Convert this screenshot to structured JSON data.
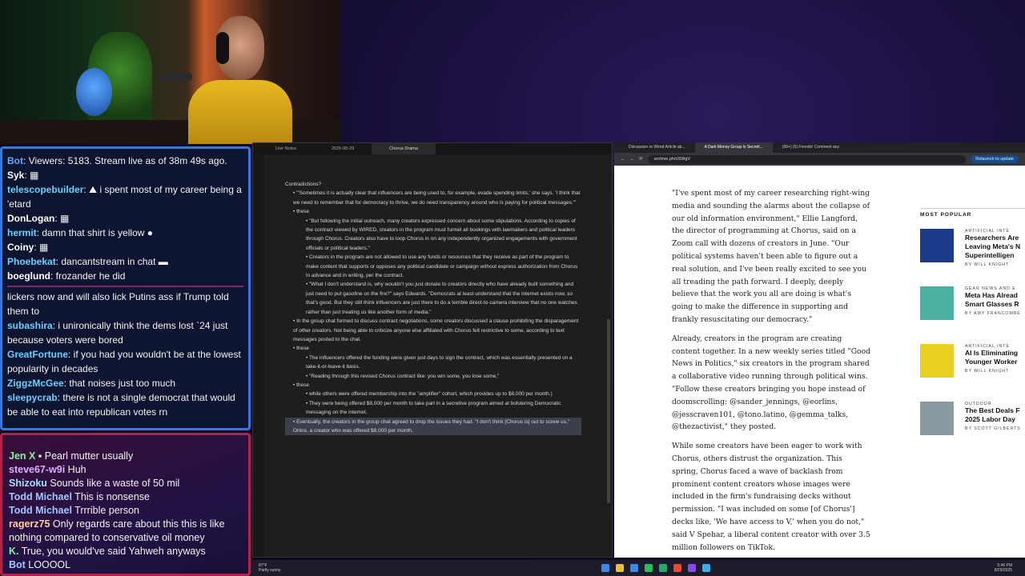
{
  "chat_top": [
    {
      "user": "Bot",
      "color": "#6aa8ff",
      "text": ": Viewers: 5183. Stream live as of 38m 49s ago."
    },
    {
      "user": "Syk",
      "color": "#ffffff",
      "text": ": ▦"
    },
    {
      "user": "telescopebuilder",
      "color": "#6ad0ff",
      "text": ": ⛰ i spent most of my career being a 'etard"
    },
    {
      "user": "DonLogan",
      "color": "#ffffff",
      "text": ": ▦"
    },
    {
      "user": "hermit",
      "color": "#6ad0ff",
      "text": ": damn that shirt is yellow ●"
    },
    {
      "user": "Coiny",
      "color": "#ffffff",
      "text": ": ▦"
    },
    {
      "user": "Phoebekat",
      "color": "#6ad0ff",
      "text": ": dancantstream in chat ▬"
    },
    {
      "user": "boeglund",
      "color": "#ffffff",
      "text": ": frozander he did"
    },
    {
      "user": "",
      "color": "#ffffff",
      "text": "lickers now and will also lick Putins ass if Trump told them to"
    },
    {
      "user": "subashira",
      "color": "#6ad0ff",
      "text": ":  i unironically think the dems lost `24 just because voters were bored"
    },
    {
      "user": "GreatFortune",
      "color": "#6ad0ff",
      "text": ":  if you had you wouldn't be at the lowest popularity in decades"
    },
    {
      "user": "ZiggzMcGee",
      "color": "#6ad0ff",
      "text": ":  that noises just too much"
    },
    {
      "user": "sleepycrab",
      "color": "#6ad0ff",
      "text": ":  there is not a single democrat that would be able to eat into republican votes rn"
    }
  ],
  "chat_bottom": [
    {
      "user": "Jen X",
      "color": "#8af0a0",
      "text": " ▪ Pearl mutter usually"
    },
    {
      "user": "steve67-w9i",
      "color": "#d8b0ff",
      "text": " Huh"
    },
    {
      "user": "Shizoku",
      "color": "#a0e0ff",
      "text": " Sounds like a waste of 50 mil"
    },
    {
      "user": "Todd Michael",
      "color": "#a0c8ff",
      "text": " This is nonsense"
    },
    {
      "user": "Todd Michael",
      "color": "#a0c8ff",
      "text": " Trrrible person"
    },
    {
      "user": "ragerz75",
      "color": "#ffd0a0",
      "text": " Only regards care about this this is like nothing compared to conservative oil money"
    },
    {
      "user": "K.",
      "color": "#8af0a0",
      "text": " True, you would've said Yahweh anyways"
    },
    {
      "user": "Bot",
      "color": "#a0c8ff",
      "text": " LOOOOL"
    }
  ],
  "obsidian": {
    "tabs": [
      "Live Notes",
      "2025-08-29",
      "Chorus Drama"
    ],
    "lines": [
      {
        "lvl": 0,
        "text": "Contradictions?"
      },
      {
        "lvl": 1,
        "text": "• \"'Sometimes it is actually clear that influencers are being used to, for example, evade spending limits,' she says. 'I think that we need to remember that for democracy to thrive, we do need transparency around who is paying for political messages.'\""
      },
      {
        "lvl": 1,
        "text": "• these"
      },
      {
        "lvl": 2,
        "text": "• \"But following the initial outreach, many creators expressed concern about some stipulations. According to copies of the contract viewed by WIRED, creators in the program must funnel all bookings with lawmakers and political leaders through Chorus. Creators also have to loop Chorus in on any independently organized engagements with government officials or political leaders.\""
      },
      {
        "lvl": 2,
        "text": "• Creators in the program are not allowed to use any funds or resources that they receive as part of the program to make content that supports or opposes any political candidate or campaign without express authorization from Chorus in advance and in writing, per the contract."
      },
      {
        "lvl": 2,
        "text": "• \"What I don't understand is, why wouldn't you just donate to creators directly who have already built something and just need to put gasoline on the fire?\" says Edwards. \"Democrats at least understand that the internet exists now, so that's good. But they still think influencers are just there to do a terrible direct-to-camera interview that no one watches rather than just treating us like another form of media.\""
      },
      {
        "lvl": 1,
        "text": "• In the group chat formed to discuss contract negotiations, some creators discussed a clause prohibiting the disparagement of other creators. Not being able to criticize anyone else affiliated with Chorus felt restrictive to some, according to text messages posted to the chat."
      },
      {
        "lvl": 1,
        "text": "• these"
      },
      {
        "lvl": 2,
        "text": "• The influencers offered the funding were given just days to sign the contract, which was essentially presented on a take-it-or-leave-it basis."
      },
      {
        "lvl": 2,
        "text": "• \"Reading through this revised Chorus contract like: you win some, you lose some,\""
      },
      {
        "lvl": 1,
        "text": "• these"
      },
      {
        "lvl": 2,
        "text": "• while others were offered membership into the \"amplifier\" cohort, which provides up to $8,000 per month.)"
      },
      {
        "lvl": 2,
        "text": "• They were being offered $8,000 per month to take part in a secretive program aimed at bolstering Democratic messaging on the internet."
      },
      {
        "lvl": 1,
        "hl": true,
        "text": "• Eventually, the creators in the group chat agreed to drop the issues they had. \"I don't think [Chorus is] out to screw us,\" Orlins, a creator who was offered $8,000 per month,"
      }
    ]
  },
  "browser": {
    "tabs": [
      "Discussion re Wired Article ab...",
      "A Dark Money Group Is Secretl...",
      "(99+) (6) Friends! Comment any"
    ],
    "url": "archive.ph/oSWgV",
    "update_label": "Relaunch to update",
    "article": [
      "\"I've spent most of my career researching right-wing media and sounding the alarms about the collapse of our old information environment,\" Ellie Langford, the director of programming at Chorus, said on a Zoom call with dozens of creators in June. \"Our political systems haven't been able to figure out a real solution, and I've been really excited to see you all treading the path forward. I deeply, deeply believe that the work you all are doing is what's going to make the difference in supporting and frankly resuscitating our democracy.\"",
      "Already, creators in the program are creating content together. In a new weekly series titled \"Good News in Politics,\" six creators in the program shared a collaborative video running through political wins. \"Follow these creators bringing you hope instead of doomscrolling: @sander_jennings, @eorlins, @jesscraven101, @tono.latino, @gemma_talks, @thezactivist,\" they posted.",
      "While some creators have been eager to work with Chorus, others distrust the organization. This spring, Chorus faced a wave of backlash from prominent content creators whose images were included in the firm's fundraising decks without permission. \"I was included on some [of Chorus'] decks like, 'We have access to V,' when you do not,\" said V Spehar, a liberal content creator with over 3.5 million followers on TikTok."
    ],
    "most_popular_heading": "MOST POPULAR",
    "most_popular": [
      {
        "cat": "ARTIFICIAL INTE",
        "title": "Researchers Are\nLeaving Meta's N\nSuperintelligen",
        "by": "BY WILL KNIGHT",
        "img": "#1a3a8a"
      },
      {
        "cat": "GEAR NEWS AND E",
        "title": "Meta Has Alread\nSmart Glasses R",
        "by": "BY AMY FRANCOMBE",
        "img": "#4ab0a0"
      },
      {
        "cat": "ARTIFICIAL INTE",
        "title": "AI Is Eliminating\nYounger Worker",
        "by": "BY WILL KNIGHT",
        "img": "#e8d020"
      },
      {
        "cat": "OUTDOOR",
        "title": "The Best Deals F\n2025 Labor Day",
        "by": "BY SCOTT GILBERTS",
        "img": "#8a9aa0"
      }
    ]
  },
  "taskbar": {
    "weather_temp": "87°F",
    "weather_desc": "Partly sunny",
    "time": "5:46 PM",
    "date": "8/29/2025"
  }
}
